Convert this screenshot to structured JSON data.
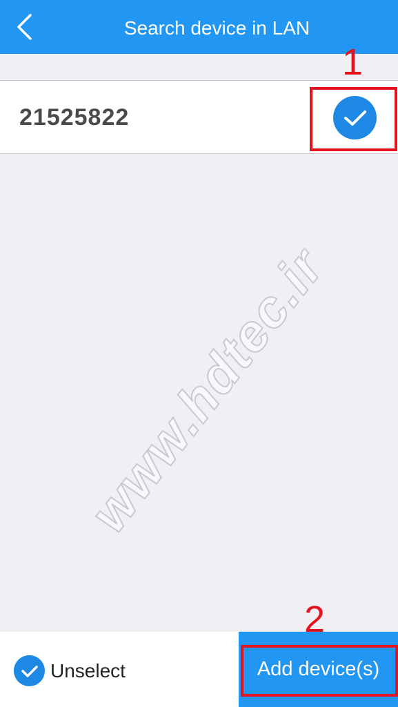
{
  "header": {
    "title": "Search device in LAN",
    "back_icon": "chevron-left-icon"
  },
  "device_list": {
    "items": [
      {
        "name": "21525822",
        "selected": true,
        "check_icon": "check-circle-icon"
      }
    ]
  },
  "bottom_bar": {
    "unselect_label": "Unselect",
    "unselect_icon": "check-circle-icon",
    "add_label": "Add device(s)"
  },
  "annotations": {
    "step1": "1",
    "step2": "2"
  },
  "watermark": "www.hdtec.ir",
  "colors": {
    "accent": "#2196f3",
    "check": "#1e88e5",
    "annotation": "#e5131d",
    "background": "#efeff4"
  }
}
